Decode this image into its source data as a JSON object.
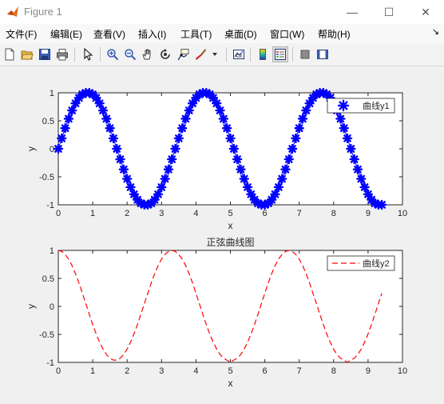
{
  "window": {
    "title": "Figure 1",
    "controls": {
      "minimize": "—",
      "maximize": "☐",
      "close": "✕"
    }
  },
  "menu": [
    "文件(F)",
    "编辑(E)",
    "查看(V)",
    "插入(I)",
    "工具(T)",
    "桌面(D)",
    "窗口(W)",
    "帮助(H)"
  ],
  "menu_overflow": "↘",
  "toolbar": {
    "icons": [
      "new-figure-icon",
      "open-file-icon",
      "save-icon",
      "print-icon",
      "pointer-icon",
      "zoom-in-icon",
      "zoom-out-icon",
      "pan-hand-icon",
      "rotate-3d-icon",
      "data-cursor-icon",
      "brush-icon",
      "link-plot-icon",
      "colorbar-icon",
      "legend-icon",
      "hide-plot-tools-icon",
      "show-plot-tools-icon"
    ]
  },
  "colors": {
    "y1": "#0000ff",
    "y2": "#ff0000",
    "axes_bg": "#ffffff",
    "figure_bg": "#f0f0f0"
  },
  "chart_data": [
    {
      "type": "line",
      "marker": "asterisk",
      "title": "",
      "xlabel": "x",
      "ylabel": "y",
      "xlim": [
        0,
        10
      ],
      "ylim": [
        -1,
        1
      ],
      "xticks": [
        "0",
        "1",
        "2",
        "3",
        "4",
        "5",
        "6",
        "7",
        "8",
        "9",
        "10"
      ],
      "yticks": [
        "-1",
        "-0.5",
        "0",
        "0.5",
        "1"
      ],
      "legend": "top-right",
      "series": [
        {
          "name": "曲线y1",
          "x": [
            0,
            0.1,
            0.2,
            0.3,
            0.4,
            0.5,
            0.6,
            0.7,
            0.8,
            0.9,
            1.0,
            1.1,
            1.2,
            1.3,
            1.4,
            1.5,
            1.6,
            1.7,
            1.8,
            1.9,
            2.0,
            2.1,
            2.2,
            2.3,
            2.4,
            2.5,
            2.6,
            2.7,
            2.8,
            2.9,
            3.0,
            3.1,
            3.2,
            3.3,
            3.4,
            3.5,
            3.6,
            3.7,
            3.8,
            3.9,
            4.0,
            4.1,
            4.2,
            4.3,
            4.4,
            4.5,
            4.6,
            4.7,
            4.8,
            4.9,
            5.0,
            5.1,
            5.2,
            5.3,
            5.4,
            5.5,
            5.6,
            5.7,
            5.8,
            5.9,
            6.0,
            6.1,
            6.2,
            6.3,
            6.4,
            6.5,
            6.6,
            6.7,
            6.8,
            6.9,
            7.0,
            7.1,
            7.2,
            7.3,
            7.4,
            7.5,
            7.6,
            7.7,
            7.8,
            7.9,
            8.0,
            8.1,
            8.2,
            8.3,
            8.4,
            8.5,
            8.6,
            8.7,
            8.8,
            8.9,
            9.0,
            9.1,
            9.2,
            9.3,
            9.4
          ],
          "y": [
            0.0,
            0.187,
            0.368,
            0.536,
            0.685,
            0.811,
            0.909,
            0.973,
            0.999,
            0.999,
            0.973,
            0.909,
            0.811,
            0.685,
            0.536,
            0.368,
            0.187,
            0.0,
            -0.187,
            -0.368,
            -0.536,
            -0.685,
            -0.811,
            -0.909,
            -0.973,
            -0.999,
            -0.999,
            -0.973,
            -0.909,
            -0.811,
            -0.685,
            -0.536,
            -0.368,
            -0.187,
            0.0,
            0.187,
            0.368,
            0.536,
            0.685,
            0.811,
            0.909,
            0.973,
            0.999,
            0.999,
            0.973,
            0.909,
            0.811,
            0.685,
            0.536,
            0.368,
            0.187,
            0.0,
            -0.187,
            -0.368,
            -0.536,
            -0.685,
            -0.811,
            -0.909,
            -0.973,
            -0.999,
            -0.999,
            -0.973,
            -0.909,
            -0.811,
            -0.685,
            -0.536,
            -0.368,
            -0.187,
            0.0,
            0.187,
            0.368,
            0.536,
            0.685,
            0.811,
            0.909,
            0.973,
            0.999,
            0.999,
            0.973,
            0.909,
            0.811,
            0.685,
            0.536,
            0.368,
            0.187,
            0.0,
            -0.187,
            -0.368,
            -0.536,
            -0.685,
            -0.811,
            -0.909,
            -0.973,
            -0.999,
            -0.999
          ]
        }
      ]
    },
    {
      "type": "line",
      "line_style": "dashed",
      "title": "正弦曲线图",
      "xlabel": "x",
      "ylabel": "y",
      "xlim": [
        0,
        10
      ],
      "ylim": [
        -1,
        1
      ],
      "xticks": [
        "0",
        "1",
        "2",
        "3",
        "4",
        "5",
        "6",
        "7",
        "8",
        "9",
        "10"
      ],
      "yticks": [
        "-1",
        "-0.5",
        "0",
        "0.5",
        "1"
      ],
      "legend": "top-right",
      "series": [
        {
          "name": "曲线y2",
          "x": [
            0,
            0.1,
            0.2,
            0.3,
            0.4,
            0.5,
            0.6,
            0.7,
            0.8,
            0.9,
            1.0,
            1.1,
            1.2,
            1.3,
            1.4,
            1.5,
            1.6,
            1.7,
            1.8,
            1.9,
            2.0,
            2.1,
            2.2,
            2.3,
            2.4,
            2.5,
            2.6,
            2.7,
            2.8,
            2.9,
            3.0,
            3.1,
            3.2,
            3.3,
            3.4,
            3.5,
            3.6,
            3.7,
            3.8,
            3.9,
            4.0,
            4.1,
            4.2,
            4.3,
            4.4,
            4.5,
            4.6,
            4.7,
            4.8,
            4.9,
            5.0,
            5.1,
            5.2,
            5.3,
            5.4,
            5.5,
            5.6,
            5.7,
            5.8,
            5.9,
            6.0,
            6.1,
            6.2,
            6.3,
            6.4,
            6.5,
            6.6,
            6.7,
            6.8,
            6.9,
            7.0,
            7.1,
            7.2,
            7.3,
            7.4,
            7.5,
            7.6,
            7.7,
            7.8,
            7.9,
            8.0,
            8.1,
            8.2,
            8.3,
            8.4,
            8.5,
            8.6,
            8.7,
            8.8,
            8.9,
            9.0,
            9.1,
            9.2,
            9.3,
            9.4
          ],
          "y": [
            1.0,
            0.982,
            0.929,
            0.844,
            0.729,
            0.585,
            0.418,
            0.233,
            0.048,
            -0.142,
            -0.324,
            -0.491,
            -0.639,
            -0.763,
            -0.859,
            -0.925,
            -0.958,
            -0.958,
            -0.925,
            -0.859,
            -0.763,
            -0.639,
            -0.491,
            -0.324,
            -0.142,
            0.048,
            0.233,
            0.418,
            0.585,
            0.729,
            0.844,
            0.929,
            0.982,
            1.0,
            0.982,
            0.929,
            0.844,
            0.729,
            0.585,
            0.418,
            0.233,
            0.048,
            -0.142,
            -0.324,
            -0.491,
            -0.639,
            -0.763,
            -0.859,
            -0.925,
            -0.958,
            -1.0,
            -0.958,
            -0.925,
            -0.859,
            -0.763,
            -0.639,
            -0.491,
            -0.324,
            -0.142,
            0.048,
            0.233,
            0.418,
            0.585,
            0.729,
            0.844,
            0.929,
            0.982,
            1.0,
            0.982,
            0.929,
            0.844,
            0.729,
            0.585,
            0.418,
            0.233,
            0.048,
            -0.142,
            -0.324,
            -0.491,
            -0.639,
            -0.763,
            -0.859,
            -0.925,
            -0.958,
            -1.0,
            -0.958,
            -0.925,
            -0.859,
            -0.763,
            -0.639,
            -0.491,
            -0.324,
            -0.142,
            0.048,
            0.233
          ]
        }
      ]
    }
  ]
}
